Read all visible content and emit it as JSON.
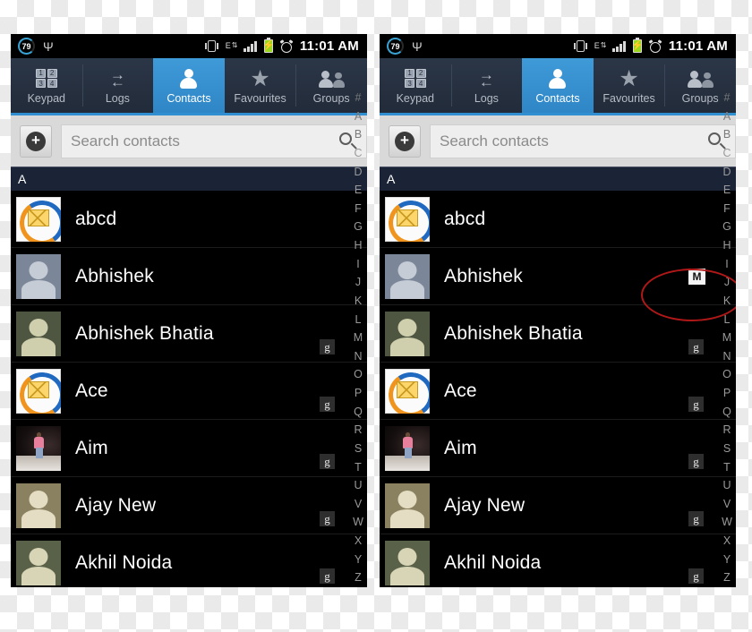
{
  "statusbar": {
    "battery_percent": "79",
    "time": "11:01 AM",
    "icons": [
      "battery-percent-circle",
      "usb-icon",
      "vibrate-icon",
      "edge-network-icon",
      "signal-icon",
      "battery-charging-icon",
      "alarm-icon"
    ]
  },
  "tabs": [
    {
      "label": "Keypad",
      "icon": "keypad-icon",
      "active": false,
      "keys": [
        "1",
        "2",
        "3",
        "4"
      ]
    },
    {
      "label": "Logs",
      "icon": "logs-swap-icon",
      "active": false
    },
    {
      "label": "Contacts",
      "icon": "person-icon",
      "active": true
    },
    {
      "label": "Favourites",
      "icon": "star-icon",
      "active": false
    },
    {
      "label": "Groups",
      "icon": "groups-icon",
      "active": false
    }
  ],
  "search": {
    "add_button": "add-contact-button",
    "placeholder": "Search contacts",
    "value": "",
    "search_icon": "search-icon"
  },
  "section_header": "A",
  "contacts": [
    {
      "name": "abcd",
      "avatar": "mail-sync",
      "badge": ""
    },
    {
      "name": "Abhishek",
      "avatar": "placeholder-blue",
      "badge": ""
    },
    {
      "name": "Abhishek Bhatia",
      "avatar": "placeholder-olive",
      "badge": "g"
    },
    {
      "name": "Ace",
      "avatar": "mail-sync",
      "badge": "g"
    },
    {
      "name": "Aim",
      "avatar": "photo",
      "badge": "g"
    },
    {
      "name": "Ajay New",
      "avatar": "placeholder-tan",
      "badge": "g"
    },
    {
      "name": "Akhil Noida",
      "avatar": "placeholder-darkolive",
      "badge": "g"
    }
  ],
  "index_strip": [
    "#",
    "A",
    "B",
    "C",
    "D",
    "E",
    "F",
    "G",
    "H",
    "I",
    "J",
    "K",
    "L",
    "M",
    "N",
    "O",
    "P",
    "Q",
    "R",
    "S",
    "T",
    "U",
    "V",
    "W",
    "X",
    "Y",
    "Z"
  ],
  "right_panel": {
    "annotation": {
      "shape": "ellipse",
      "color": "#b01818",
      "target": "memo-badge"
    },
    "memo_badge": "M"
  },
  "colors": {
    "accent_blue": "#2f8fd0",
    "tab_bg": "#2b3647",
    "section_bg": "#1b2336",
    "list_bg": "#000000",
    "annotation_red": "#b01818"
  }
}
